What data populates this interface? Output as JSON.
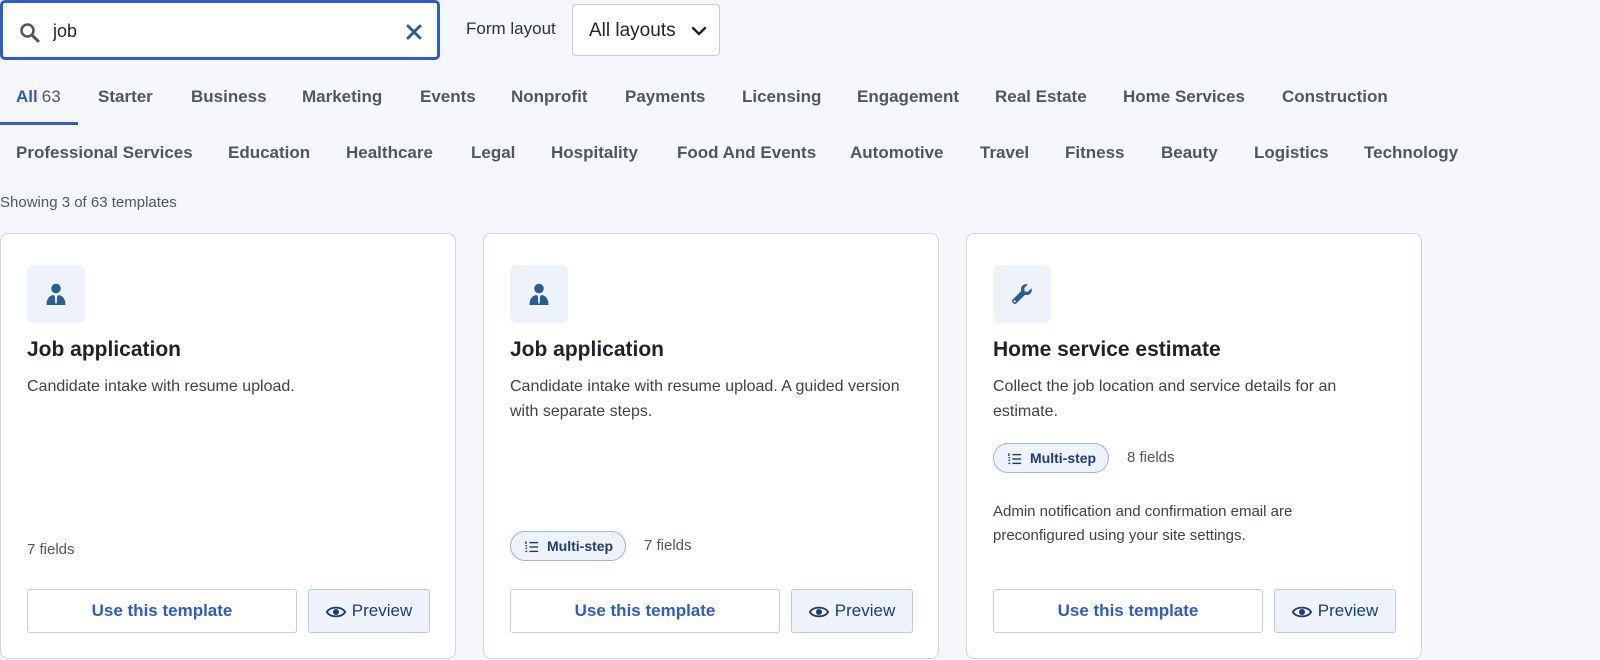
{
  "search": {
    "value": "job",
    "placeholder": ""
  },
  "form_layout": {
    "label": "Form layout",
    "selected": "All layouts"
  },
  "tabs_row1": [
    {
      "label": "All",
      "count": "63",
      "active": true
    },
    {
      "label": "Starter"
    },
    {
      "label": "Business"
    },
    {
      "label": "Marketing"
    },
    {
      "label": "Events"
    },
    {
      "label": "Nonprofit"
    },
    {
      "label": "Payments"
    },
    {
      "label": "Licensing"
    },
    {
      "label": "Engagement"
    },
    {
      "label": "Real Estate"
    },
    {
      "label": "Home Services"
    },
    {
      "label": "Construction"
    }
  ],
  "tabs_row2": [
    {
      "label": "Professional Services"
    },
    {
      "label": "Education"
    },
    {
      "label": "Healthcare"
    },
    {
      "label": "Legal"
    },
    {
      "label": "Hospitality"
    },
    {
      "label": "Food And Events"
    },
    {
      "label": "Automotive"
    },
    {
      "label": "Travel"
    },
    {
      "label": "Fitness"
    },
    {
      "label": "Beauty"
    },
    {
      "label": "Logistics"
    },
    {
      "label": "Technology"
    }
  ],
  "showing": "Showing 3 of 63 templates",
  "cards": [
    {
      "icon": "user-tie-icon",
      "title": "Job application",
      "description": "Candidate intake with resume upload.",
      "multistep": "",
      "fields": "7 fields",
      "note": "",
      "use_label": "Use this template",
      "preview_label": "Preview"
    },
    {
      "icon": "user-tie-icon",
      "title": "Job application",
      "description": "Candidate intake with resume upload. A guided version with separate steps.",
      "multistep": "Multi-step",
      "fields": "7 fields",
      "note": "",
      "use_label": "Use this template",
      "preview_label": "Preview"
    },
    {
      "icon": "wrench-icon",
      "title": "Home service estimate",
      "description": "Collect the job location and service details for an estimate.",
      "multistep": "Multi-step",
      "fields": "8 fields",
      "note": "Admin notification and confirmation email are preconfigured using your site settings.",
      "use_label": "Use this template",
      "preview_label": "Preview"
    }
  ],
  "colors": {
    "accent": "#2d5bd0",
    "icon": "#2a5d94",
    "pill_bg": "#eef3fb",
    "pill_text": "#1e3a78",
    "background": "#f6f7fb"
  }
}
